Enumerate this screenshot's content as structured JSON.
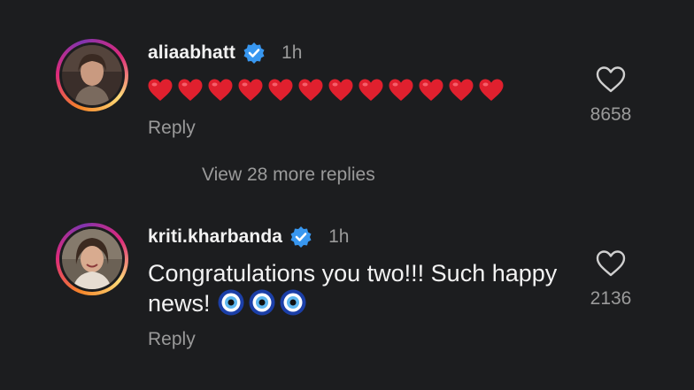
{
  "comments": [
    {
      "username": "aliaabhatt",
      "verified": true,
      "time": "1h",
      "text": "❤️❤️❤️❤️❤️❤️❤️❤️❤️❤️❤️❤️",
      "emoji_count": 12,
      "emoji": "red-heart",
      "reply_label": "Reply",
      "likes": "8658",
      "avatar": "profile-photo"
    },
    {
      "username": "kriti.kharbanda",
      "verified": true,
      "time": "1h",
      "text_line1": "Congratulations you two!!! Such happy",
      "text_line2": "news!",
      "trailing_emoji": "evil-eye",
      "trailing_emoji_count": 3,
      "reply_label": "Reply",
      "likes": "2136",
      "avatar": "profile-photo"
    }
  ],
  "view_more_replies": "View 28 more replies",
  "colors": {
    "background": "#1c1d1f",
    "primary_text": "#f2f2f2",
    "secondary_text": "#9a9a9a",
    "verified_blue": "#3897f0",
    "heart_red": "#e0202e"
  },
  "icons": [
    "heart-outline-icon",
    "verified-badge-icon",
    "red-heart-emoji",
    "evil-eye-emoji"
  ]
}
